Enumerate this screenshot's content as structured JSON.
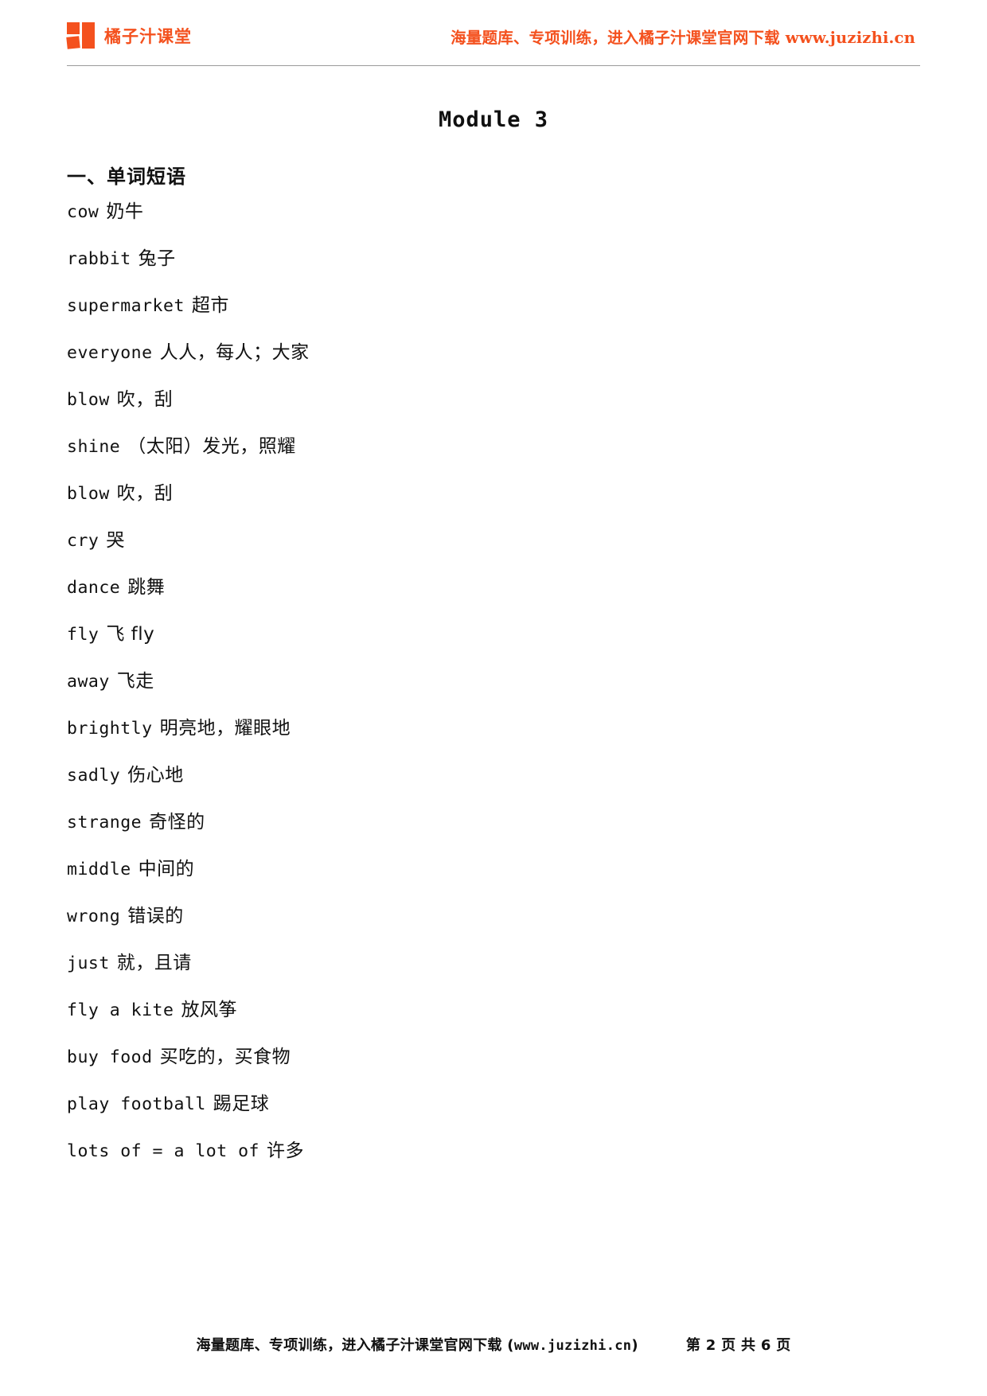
{
  "header": {
    "logo_icon": "orange-squares-logo-icon",
    "brand_name": "橘子汁课堂",
    "slogan": "海量题库、专项训练，进入橘子汁课堂官网下载 www.juzizhi.cn",
    "brand_color": "#f4511e"
  },
  "document": {
    "title": "Module 3",
    "section_heading": "一、单词短语",
    "vocabulary": [
      {
        "term": "cow",
        "gloss": "奶牛"
      },
      {
        "term": "rabbit",
        "gloss": "兔子"
      },
      {
        "term": "supermarket",
        "gloss": "超市"
      },
      {
        "term": "everyone",
        "gloss": "人人，每人；大家"
      },
      {
        "term": "blow",
        "gloss": "吹，刮"
      },
      {
        "term": "shine",
        "gloss": "（太阳）发光，照耀"
      },
      {
        "term": "blow",
        "gloss": "吹，刮"
      },
      {
        "term": "cry",
        "gloss": "哭"
      },
      {
        "term": "dance",
        "gloss": "跳舞"
      },
      {
        "term": "fly",
        "gloss": "飞 fly"
      },
      {
        "term": "away",
        "gloss": "飞走"
      },
      {
        "term": "brightly",
        "gloss": "明亮地，耀眼地"
      },
      {
        "term": "sadly",
        "gloss": "伤心地"
      },
      {
        "term": "strange",
        "gloss": "奇怪的"
      },
      {
        "term": "middle",
        "gloss": "中间的"
      },
      {
        "term": "wrong",
        "gloss": "错误的"
      },
      {
        "term": "just",
        "gloss": "就，且请"
      },
      {
        "term": "fly a kite",
        "gloss": "放风筝"
      },
      {
        "term": "buy food",
        "gloss": "买吃的，买食物"
      },
      {
        "term": "play football",
        "gloss": "踢足球"
      },
      {
        "term": "lots of = a lot of",
        "gloss": "许多"
      }
    ]
  },
  "footer": {
    "note_prefix": "海量题库、专项训练，进入橘子汁课堂官网下载 (",
    "note_url": "www.juzizhi.cn",
    "note_suffix": ")",
    "pager": "第 2 页 共 6 页"
  }
}
